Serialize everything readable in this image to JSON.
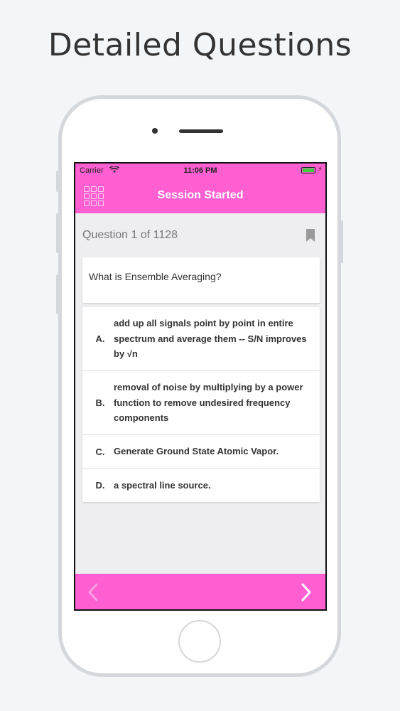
{
  "headline": "Detailed Questions",
  "status_bar": {
    "carrier": "Carrier",
    "time": "11:06 PM"
  },
  "nav": {
    "title": "Session Started"
  },
  "question": {
    "counter": "Question 1 of 1128",
    "text": "What is Ensemble Averaging?"
  },
  "answers": [
    {
      "letter": "A.",
      "text": "add up all signals point by point in entire spectrum and average them -- S/N improves by √n"
    },
    {
      "letter": "B.",
      "text": "removal of noise by multiplying by a power function to remove undesired frequency components"
    },
    {
      "letter": "C.",
      "text": "Generate Ground State Atomic Vapor."
    },
    {
      "letter": "D.",
      "text": "a spectral line source."
    }
  ],
  "colors": {
    "accent": "#ff5fd1",
    "battery": "#3ad13a"
  },
  "icons": [
    "grid-menu-icon",
    "bookmark-icon",
    "chevron-left-icon",
    "chevron-right-icon",
    "wifi-icon",
    "battery-icon"
  ]
}
